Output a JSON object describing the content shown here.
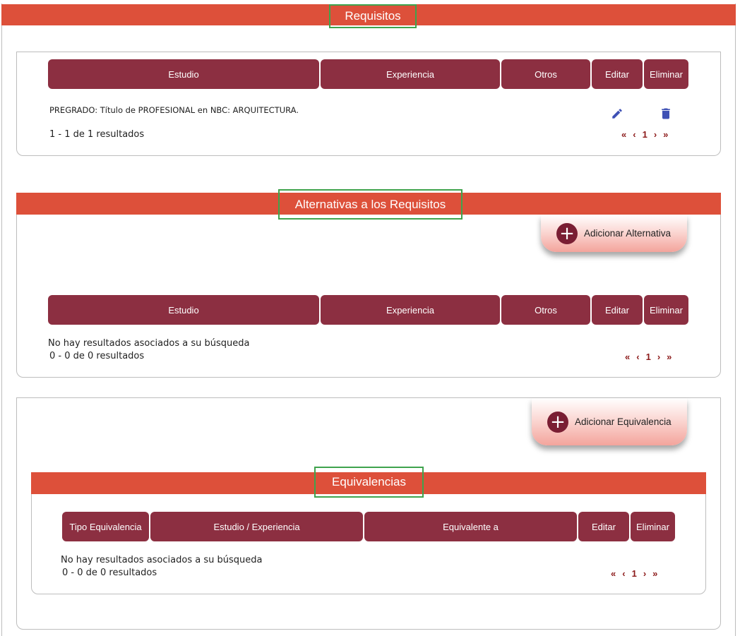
{
  "requisitos": {
    "title": "Requisitos",
    "columns": [
      "Estudio",
      "Experiencia",
      "Otros",
      "Editar",
      "Eliminar"
    ],
    "row": {
      "estudio": "PREGRADO: Título de PROFESIONAL en NBC: ARQUITECTURA."
    },
    "results": "1 - 1 de 1 resultados",
    "pager": {
      "first": "«",
      "prev": "‹",
      "page": "1",
      "next": "›",
      "last": "»"
    }
  },
  "alternativas": {
    "title": "Alternativas a los Requisitos",
    "add_label": "Adicionar Alternativa",
    "columns": [
      "Estudio",
      "Experiencia",
      "Otros",
      "Editar",
      "Eliminar"
    ],
    "empty": "No hay resultados asociados a su búsqueda",
    "results": "0 - 0 de 0 resultados",
    "pager": {
      "first": "«",
      "prev": "‹",
      "page": "1",
      "next": "›",
      "last": "»"
    }
  },
  "equivalencias": {
    "title": "Equivalencias",
    "add_label": "Adicionar Equivalencia",
    "columns": [
      "Tipo Equivalencia",
      "Estudio / Experiencia",
      "Equivalente a",
      "Editar",
      "Eliminar"
    ],
    "empty": "No hay resultados asociados a su búsqueda",
    "results": "0 - 0 de 0 resultados",
    "pager": {
      "first": "«",
      "prev": "‹",
      "page": "1",
      "next": "›",
      "last": "»"
    }
  },
  "colors": {
    "band": "#dd503a",
    "header": "#8c2f41",
    "highlight": "#3fa34d",
    "pager": "#8c1a1a",
    "icon_blue": "#3f51b5",
    "plus_bg": "#7a1e33"
  },
  "icons": {
    "edit": "pencil-icon",
    "delete": "trash-icon",
    "add": "plus-circle-icon"
  }
}
